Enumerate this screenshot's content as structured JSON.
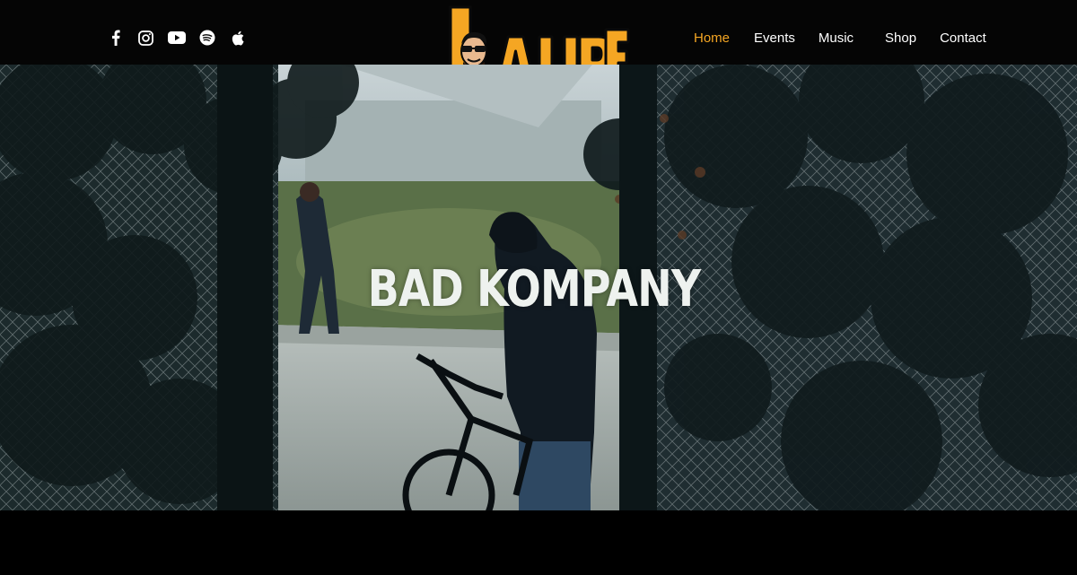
{
  "social": {
    "icons": [
      "facebook-icon",
      "instagram-icon",
      "youtube-icon",
      "spotify-icon",
      "apple-icon"
    ]
  },
  "logo": {
    "text": "LAURE",
    "colors": {
      "fill": "#f5a623",
      "outline": "#0a0a0a",
      "face": "#e9b98f"
    }
  },
  "nav": {
    "items": [
      {
        "label": "Home"
      },
      {
        "label": "Events"
      },
      {
        "label": "Music"
      },
      {
        "label": "Shop"
      },
      {
        "label": "Contact"
      }
    ],
    "active_color": "#f5a623"
  },
  "hero": {
    "title": "BAD KOMPANY"
  }
}
